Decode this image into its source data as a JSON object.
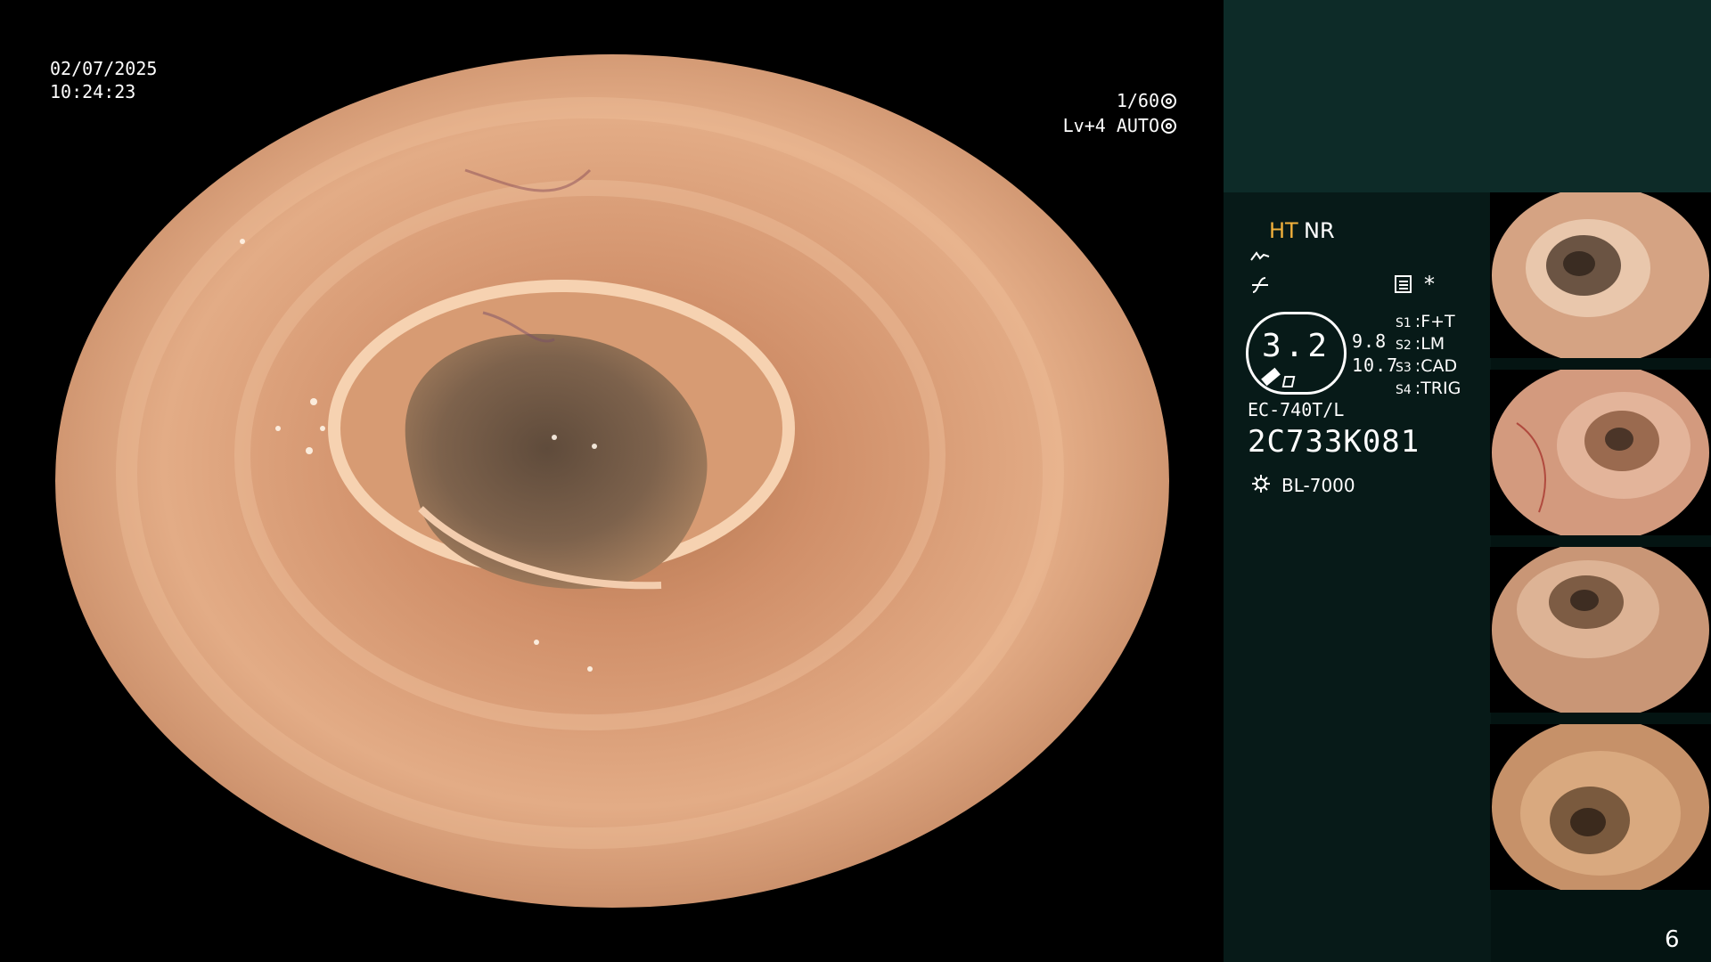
{
  "overlay": {
    "date": "02/07/2025",
    "time": "10:24:23",
    "shutter": "1/60",
    "brightness": "Lv+4 AUTO"
  },
  "side_panel": {
    "ht": "HT",
    "nr": "NR",
    "star": "*",
    "zoom": "3.2",
    "mag_top": "9.8",
    "mag_bottom": "10.7",
    "switches": [
      {
        "key": "S1",
        "value": "F+T"
      },
      {
        "key": "S2",
        "value": "LM"
      },
      {
        "key": "S3",
        "value": "CAD"
      },
      {
        "key": "S4",
        "value": "TRIG"
      }
    ],
    "scope_model": "EC-740T/L",
    "scope_serial": "2C733K081",
    "light_source": "BL-7000",
    "page_number": "6"
  },
  "thumbnails": [
    {
      "id": 1
    },
    {
      "id": 2
    },
    {
      "id": 3
    },
    {
      "id": 4
    }
  ],
  "colors": {
    "ht_accent": "#f2b13c",
    "panel_top": "#0d2b28",
    "panel_bottom": "#041412"
  }
}
